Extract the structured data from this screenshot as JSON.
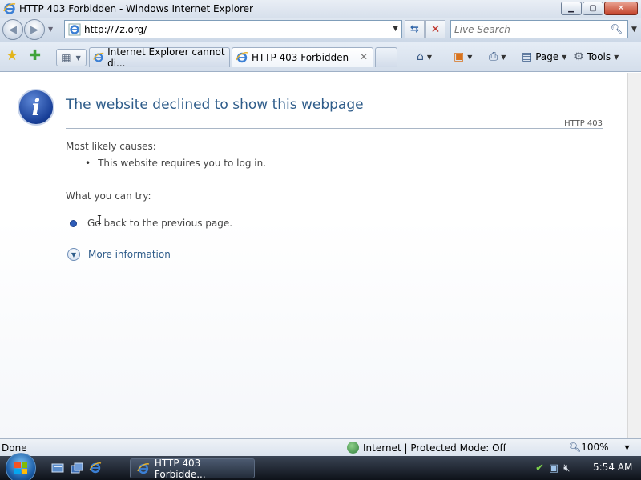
{
  "window": {
    "title": "HTTP 403 Forbidden - Windows Internet Explorer",
    "buttons": {
      "minimize": "▁",
      "maximize": "▢",
      "close": "✕"
    }
  },
  "address_bar": {
    "url": "http://7z.org/",
    "search_placeholder": "Live Search"
  },
  "tabs": [
    {
      "label": "Internet Explorer cannot di...",
      "active": false
    },
    {
      "label": "HTTP 403 Forbidden",
      "active": true
    }
  ],
  "command_bar": {
    "page_label": "Page",
    "tools_label": "Tools"
  },
  "error_page": {
    "heading": "The website declined to show this webpage",
    "code": "HTTP 403",
    "causes_title": "Most likely causes:",
    "causes": [
      "This website requires you to log in."
    ],
    "try_title": "What you can try:",
    "go_back": "Go back to the previous page.",
    "more_info": "More information"
  },
  "status_bar": {
    "status": "Done",
    "zone": "Internet | Protected Mode: Off",
    "zoom": "100%"
  },
  "taskbar": {
    "window_button": "HTTP 403 Forbidde...",
    "clock": "5:54 AM"
  },
  "icons": [
    "ie-icon",
    "back-icon",
    "forward-icon",
    "refresh-icon",
    "stop-icon",
    "search-icon",
    "favorites-star-icon",
    "add-favorites-icon",
    "quick-tabs-icon",
    "home-icon",
    "feeds-icon",
    "print-icon",
    "page-icon",
    "tools-gear-icon",
    "info-icon",
    "globe-icon",
    "zoom-icon",
    "windows-start-icon"
  ]
}
